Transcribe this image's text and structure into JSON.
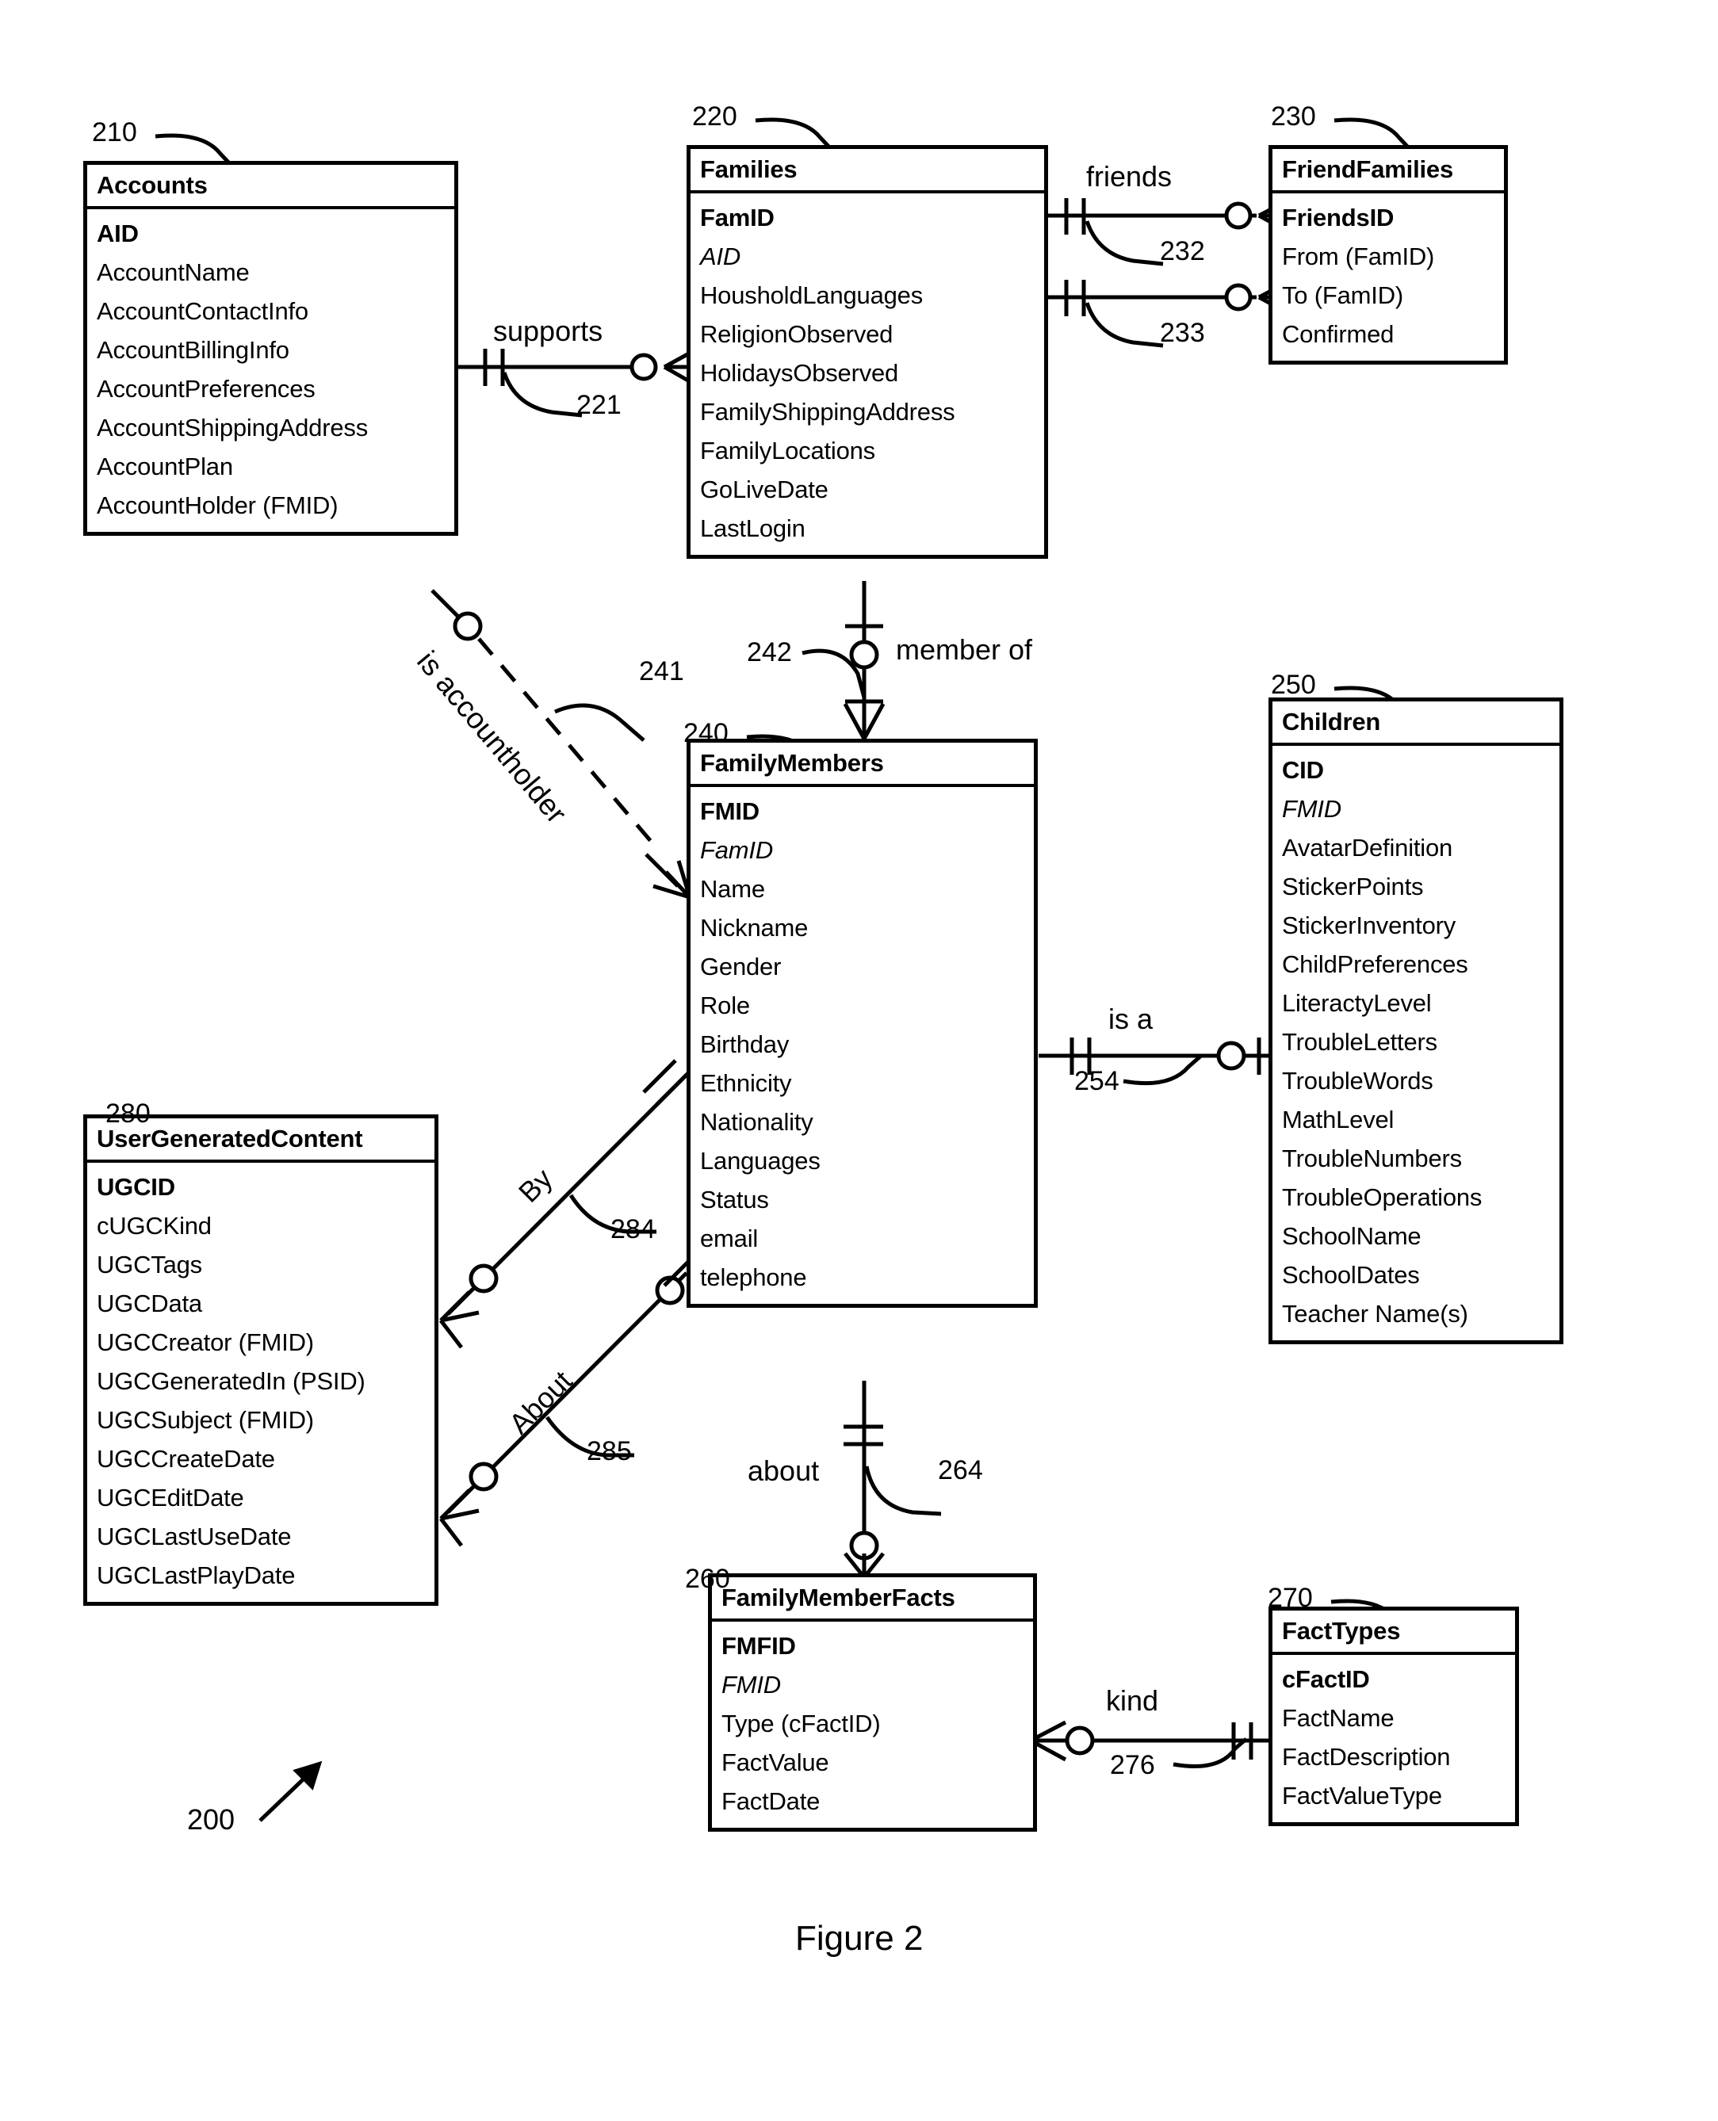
{
  "figure": {
    "caption": "Figure 2",
    "diagram_ref": "200"
  },
  "entities": [
    {
      "id": "accounts",
      "ref": "210",
      "name": "Accounts",
      "attributes": [
        {
          "label": "AID",
          "key": "pk"
        },
        {
          "label": "AccountName",
          "key": ""
        },
        {
          "label": "AccountContactInfo",
          "key": ""
        },
        {
          "label": "AccountBillingInfo",
          "key": ""
        },
        {
          "label": "AccountPreferences",
          "key": ""
        },
        {
          "label": "AccountShippingAddress",
          "key": ""
        },
        {
          "label": "AccountPlan",
          "key": ""
        },
        {
          "label": "AccountHolder (FMID)",
          "key": ""
        }
      ]
    },
    {
      "id": "families",
      "ref": "220",
      "name": "Families",
      "attributes": [
        {
          "label": "FamID",
          "key": "pk"
        },
        {
          "label": "AID",
          "key": "fk"
        },
        {
          "label": "HousholdLanguages",
          "key": ""
        },
        {
          "label": "ReligionObserved",
          "key": ""
        },
        {
          "label": "HolidaysObserved",
          "key": ""
        },
        {
          "label": "FamilyShippingAddress",
          "key": ""
        },
        {
          "label": "FamilyLocations",
          "key": ""
        },
        {
          "label": "GoLiveDate",
          "key": ""
        },
        {
          "label": "LastLogin",
          "key": ""
        }
      ]
    },
    {
      "id": "friendfamilies",
      "ref": "230",
      "name": "FriendFamilies",
      "attributes": [
        {
          "label": "FriendsID",
          "key": "pk"
        },
        {
          "label": "From (FamID)",
          "key": ""
        },
        {
          "label": "To (FamID)",
          "key": ""
        },
        {
          "label": "Confirmed",
          "key": ""
        }
      ]
    },
    {
      "id": "familymembers",
      "ref": "240",
      "name": "FamilyMembers",
      "attributes": [
        {
          "label": "FMID",
          "key": "pk"
        },
        {
          "label": "FamID",
          "key": "fk"
        },
        {
          "label": "Name",
          "key": ""
        },
        {
          "label": "Nickname",
          "key": ""
        },
        {
          "label": "Gender",
          "key": ""
        },
        {
          "label": "Role",
          "key": ""
        },
        {
          "label": "Birthday",
          "key": ""
        },
        {
          "label": "Ethnicity",
          "key": ""
        },
        {
          "label": "Nationality",
          "key": ""
        },
        {
          "label": "Languages",
          "key": ""
        },
        {
          "label": "Status",
          "key": ""
        },
        {
          "label": "email",
          "key": ""
        },
        {
          "label": "telephone",
          "key": ""
        }
      ]
    },
    {
      "id": "children",
      "ref": "250",
      "name": "Children",
      "attributes": [
        {
          "label": "CID",
          "key": "pk"
        },
        {
          "label": "FMID",
          "key": "fk"
        },
        {
          "label": "AvatarDefinition",
          "key": ""
        },
        {
          "label": "StickerPoints",
          "key": ""
        },
        {
          "label": "StickerInventory",
          "key": ""
        },
        {
          "label": "ChildPreferences",
          "key": ""
        },
        {
          "label": "LiteractyLevel",
          "key": ""
        },
        {
          "label": "TroubleLetters",
          "key": ""
        },
        {
          "label": "TroubleWords",
          "key": ""
        },
        {
          "label": "MathLevel",
          "key": ""
        },
        {
          "label": "TroubleNumbers",
          "key": ""
        },
        {
          "label": "TroubleOperations",
          "key": ""
        },
        {
          "label": "SchoolName",
          "key": ""
        },
        {
          "label": "SchoolDates",
          "key": ""
        },
        {
          "label": "Teacher Name(s)",
          "key": ""
        }
      ]
    },
    {
      "id": "familymemberfacts",
      "ref": "260",
      "name": "FamilyMemberFacts",
      "attributes": [
        {
          "label": "FMFID",
          "key": "pk"
        },
        {
          "label": "FMID",
          "key": "fk"
        },
        {
          "label": "Type (cFactID)",
          "key": ""
        },
        {
          "label": "FactValue",
          "key": ""
        },
        {
          "label": "FactDate",
          "key": ""
        }
      ]
    },
    {
      "id": "facttypes",
      "ref": "270",
      "name": "FactTypes",
      "attributes": [
        {
          "label": "cFactID",
          "key": "pk"
        },
        {
          "label": "FactName",
          "key": ""
        },
        {
          "label": "FactDescription",
          "key": ""
        },
        {
          "label": "FactValueType",
          "key": ""
        }
      ]
    },
    {
      "id": "usergeneratedcontent",
      "ref": "280",
      "name": "UserGeneratedContent",
      "attributes": [
        {
          "label": "UGCID",
          "key": "pk"
        },
        {
          "label": "cUGCKind",
          "key": ""
        },
        {
          "label": "UGCTags",
          "key": ""
        },
        {
          "label": "UGCData",
          "key": ""
        },
        {
          "label": "UGCCreator (FMID)",
          "key": ""
        },
        {
          "label": "UGCGeneratedIn (PSID)",
          "key": ""
        },
        {
          "label": "UGCSubject (FMID)",
          "key": ""
        },
        {
          "label": "UGCCreateDate",
          "key": ""
        },
        {
          "label": "UGCEditDate",
          "key": ""
        },
        {
          "label": "UGCLastUseDate",
          "key": ""
        },
        {
          "label": "UGCLastPlayDate",
          "key": ""
        }
      ]
    }
  ],
  "relationships": [
    {
      "id": "supports",
      "ref": "221",
      "label": "supports",
      "from": "accounts",
      "to": "families"
    },
    {
      "id": "friends_from",
      "ref": "232",
      "label": "friends",
      "from": "families",
      "to": "friendfamilies"
    },
    {
      "id": "friends_to",
      "ref": "233",
      "label": "",
      "from": "families",
      "to": "friendfamilies"
    },
    {
      "id": "is_accountholder",
      "ref": "241",
      "label": "is accountholder",
      "from": "accounts",
      "to": "familymembers"
    },
    {
      "id": "member_of",
      "ref": "242",
      "label": "member of",
      "from": "families",
      "to": "familymembers"
    },
    {
      "id": "is_a",
      "ref": "254",
      "label": "is a",
      "from": "familymembers",
      "to": "children"
    },
    {
      "id": "about",
      "ref": "264",
      "label": "about",
      "from": "familymembers",
      "to": "familymemberfacts"
    },
    {
      "id": "kind",
      "ref": "276",
      "label": "kind",
      "from": "familymemberfacts",
      "to": "facttypes"
    },
    {
      "id": "by",
      "ref": "284",
      "label": "By",
      "from": "usergeneratedcontent",
      "to": "familymembers"
    },
    {
      "id": "about_ugc",
      "ref": "285",
      "label": "About",
      "from": "usergeneratedcontent",
      "to": "familymembers"
    }
  ]
}
